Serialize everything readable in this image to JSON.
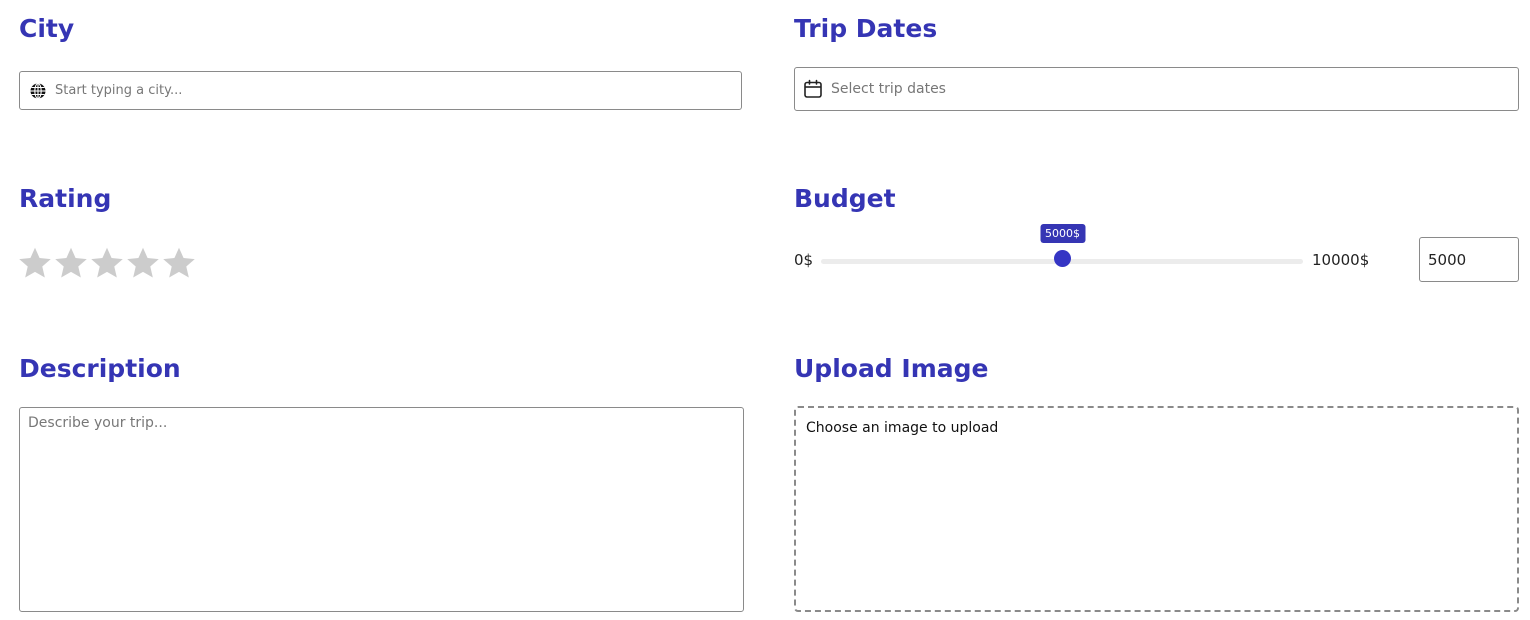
{
  "city": {
    "heading": "City",
    "placeholder": "Start typing a city...",
    "icon": "globe-icon"
  },
  "trip_dates": {
    "heading": "Trip Dates",
    "placeholder": "Select trip dates",
    "icon": "calendar-icon"
  },
  "rating": {
    "heading": "Rating",
    "max_stars": 5,
    "value": 0,
    "empty_color": "#cccccc"
  },
  "budget": {
    "heading": "Budget",
    "min_label": "0$",
    "max_label": "10000$",
    "min": 0,
    "max": 10000,
    "value": 5000,
    "tooltip": "5000$",
    "input_value": "5000"
  },
  "description": {
    "heading": "Description",
    "placeholder": "Describe your trip..."
  },
  "upload": {
    "heading": "Upload Image",
    "text": "Choose an image to upload"
  },
  "colors": {
    "accent": "#3535b4",
    "border": "#8a8a8a",
    "track": "#ececec"
  }
}
